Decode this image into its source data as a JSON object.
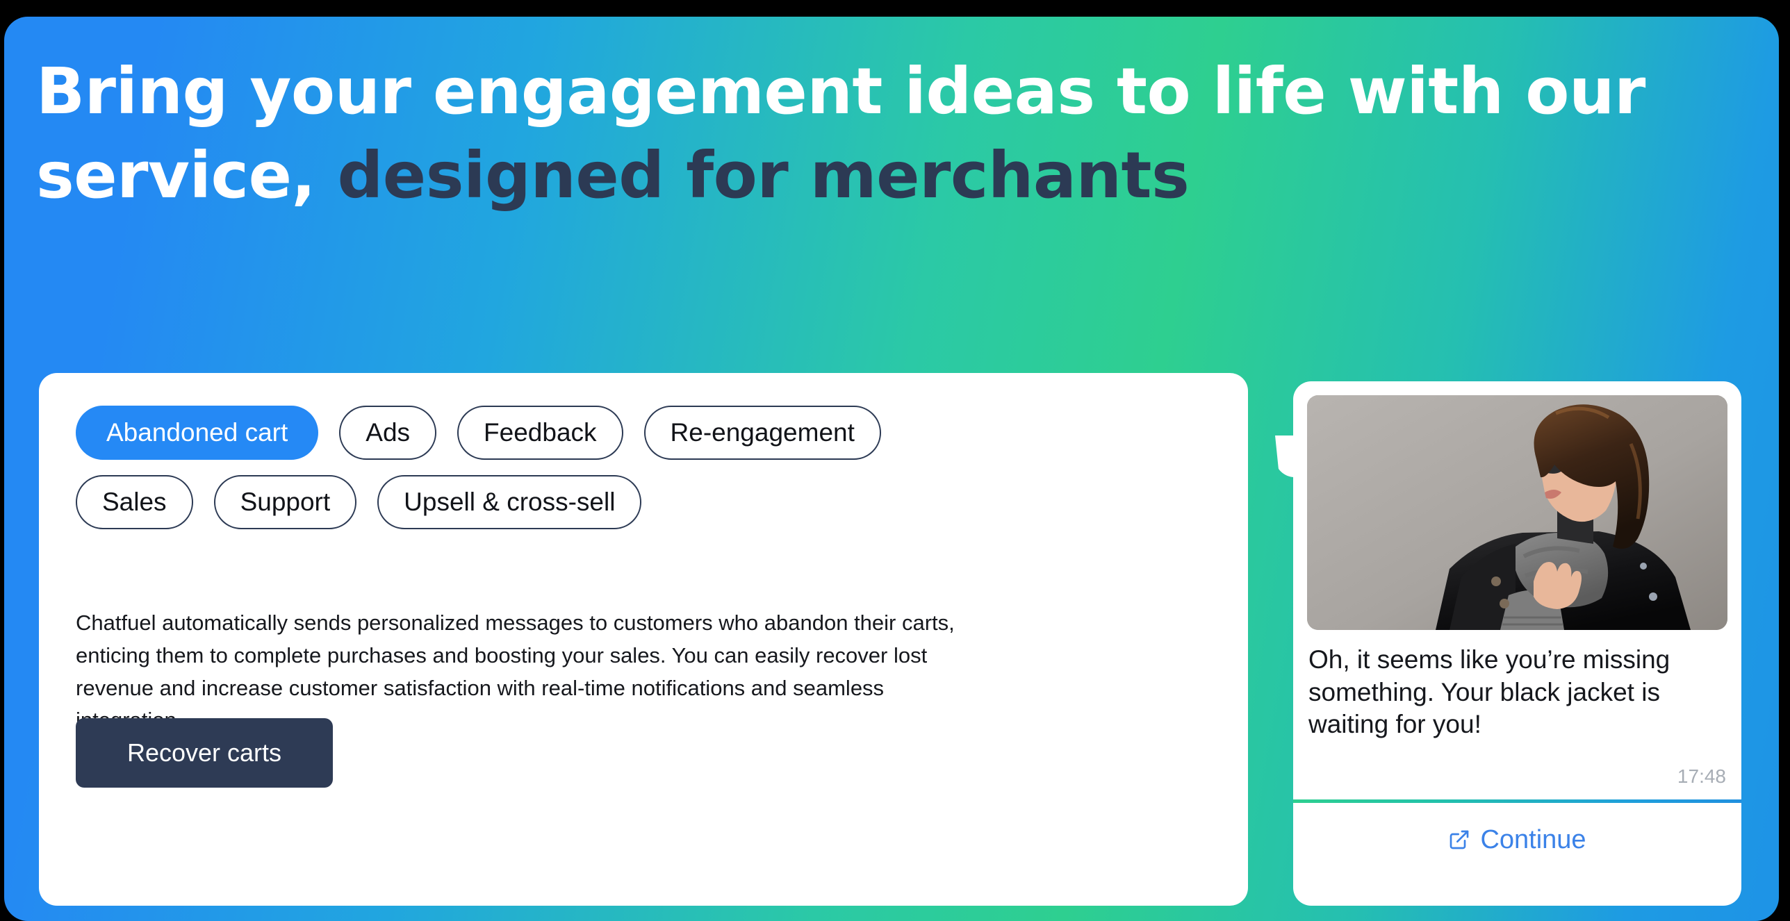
{
  "hero": {
    "headline_part1": "Bring your engagement ideas to life with our service,",
    "headline_part2": " designed for merchants",
    "gradient_start": "#2489F3",
    "gradient_mid": "#2ECF90",
    "gradient_end": "#1E93E6",
    "headline_light_color": "#FFFFFF",
    "headline_dark_color": "#2C3A54"
  },
  "filters": {
    "row1": [
      {
        "label": "Abandoned cart",
        "active": true
      },
      {
        "label": "Ads",
        "active": false
      },
      {
        "label": "Feedback",
        "active": false
      },
      {
        "label": "Re-engagement",
        "active": false
      }
    ],
    "row2": [
      {
        "label": "Sales",
        "active": false
      },
      {
        "label": "Support",
        "active": false
      },
      {
        "label": "Upsell & cross-sell",
        "active": false
      }
    ],
    "active_color": "#2589F5",
    "border_color": "#2C3A54"
  },
  "panel": {
    "description": "Chatfuel automatically sends personalized messages to customers who abandon their carts, enticing them to complete purchases and boosting your sales. You can easily recover lost revenue and increase customer satisfaction with real-time notifications and seamless integration.",
    "cta_label": "Recover carts",
    "cta_color": "#2E3B55"
  },
  "chat": {
    "image_alt": "woman-in-sunglasses-and-black-leather-jacket-photo",
    "message": "Oh, it seems like you’re missing something. Your black jacket is waiting for you!",
    "timestamp": "17:48",
    "continue_label": "Continue",
    "continue_icon": "external-link-icon",
    "link_color": "#3B82E8"
  }
}
